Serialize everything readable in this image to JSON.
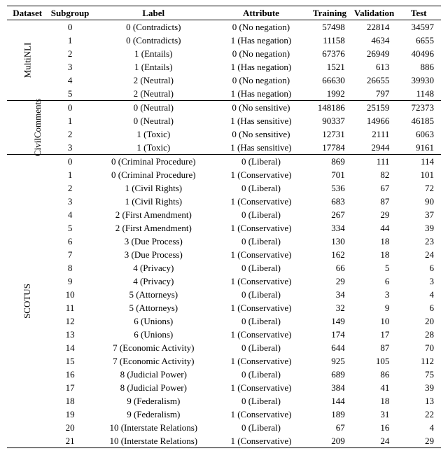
{
  "columns": {
    "dataset": "Dataset",
    "subgroup": "Subgroup",
    "label": "Label",
    "attribute": "Attribute",
    "training": "Training",
    "validation": "Validation",
    "test": "Test"
  },
  "groups": [
    {
      "name": "MultiNLI",
      "rows": [
        {
          "subgroup": "0",
          "label": "0 (Contradicts)",
          "attribute": "0 (No negation)",
          "training": "57498",
          "validation": "22814",
          "test": "34597"
        },
        {
          "subgroup": "1",
          "label": "0 (Contradicts)",
          "attribute": "1 (Has negation)",
          "training": "11158",
          "validation": "4634",
          "test": "6655"
        },
        {
          "subgroup": "2",
          "label": "1 (Entails)",
          "attribute": "0 (No negation)",
          "training": "67376",
          "validation": "26949",
          "test": "40496"
        },
        {
          "subgroup": "3",
          "label": "1 (Entails)",
          "attribute": "1 (Has negation)",
          "training": "1521",
          "validation": "613",
          "test": "886"
        },
        {
          "subgroup": "4",
          "label": "2 (Neutral)",
          "attribute": "0 (No negation)",
          "training": "66630",
          "validation": "26655",
          "test": "39930"
        },
        {
          "subgroup": "5",
          "label": "2 (Neutral)",
          "attribute": "1 (Has negation)",
          "training": "1992",
          "validation": "797",
          "test": "1148"
        }
      ]
    },
    {
      "name": "CivilComments",
      "rows": [
        {
          "subgroup": "0",
          "label": "0 (Neutral)",
          "attribute": "0 (No sensitive)",
          "training": "148186",
          "validation": "25159",
          "test": "72373"
        },
        {
          "subgroup": "1",
          "label": "0 (Neutral)",
          "attribute": "1 (Has sensitive)",
          "training": "90337",
          "validation": "14966",
          "test": "46185"
        },
        {
          "subgroup": "2",
          "label": "1 (Toxic)",
          "attribute": "0 (No sensitive)",
          "training": "12731",
          "validation": "2111",
          "test": "6063"
        },
        {
          "subgroup": "3",
          "label": "1 (Toxic)",
          "attribute": "1 (Has sensitive)",
          "training": "17784",
          "validation": "2944",
          "test": "9161"
        }
      ]
    },
    {
      "name": "SCOTUS",
      "rows": [
        {
          "subgroup": "0",
          "label": "0 (Criminal Procedure)",
          "attribute": "0 (Liberal)",
          "training": "869",
          "validation": "111",
          "test": "114"
        },
        {
          "subgroup": "1",
          "label": "0 (Criminal Procedure)",
          "attribute": "1 (Conservative)",
          "training": "701",
          "validation": "82",
          "test": "101"
        },
        {
          "subgroup": "2",
          "label": "1 (Civil Rights)",
          "attribute": "0 (Liberal)",
          "training": "536",
          "validation": "67",
          "test": "72"
        },
        {
          "subgroup": "3",
          "label": "1 (Civil Rights)",
          "attribute": "1 (Conservative)",
          "training": "683",
          "validation": "87",
          "test": "90"
        },
        {
          "subgroup": "4",
          "label": "2 (First Amendment)",
          "attribute": "0 (Liberal)",
          "training": "267",
          "validation": "29",
          "test": "37"
        },
        {
          "subgroup": "5",
          "label": "2 (First Amendment)",
          "attribute": "1 (Conservative)",
          "training": "334",
          "validation": "44",
          "test": "39"
        },
        {
          "subgroup": "6",
          "label": "3 (Due Process)",
          "attribute": "0 (Liberal)",
          "training": "130",
          "validation": "18",
          "test": "23"
        },
        {
          "subgroup": "7",
          "label": "3 (Due Process)",
          "attribute": "1 (Conservative)",
          "training": "162",
          "validation": "18",
          "test": "24"
        },
        {
          "subgroup": "8",
          "label": "4 (Privacy)",
          "attribute": "0 (Liberal)",
          "training": "66",
          "validation": "5",
          "test": "6"
        },
        {
          "subgroup": "9",
          "label": "4 (Privacy)",
          "attribute": "1 (Conservative)",
          "training": "29",
          "validation": "6",
          "test": "3"
        },
        {
          "subgroup": "10",
          "label": "5 (Attorneys)",
          "attribute": "0 (Liberal)",
          "training": "34",
          "validation": "3",
          "test": "4"
        },
        {
          "subgroup": "11",
          "label": "5 (Attorneys)",
          "attribute": "1 (Conservative)",
          "training": "32",
          "validation": "9",
          "test": "6"
        },
        {
          "subgroup": "12",
          "label": "6 (Unions)",
          "attribute": "0 (Liberal)",
          "training": "149",
          "validation": "10",
          "test": "20"
        },
        {
          "subgroup": "13",
          "label": "6 (Unions)",
          "attribute": "1 (Conservative)",
          "training": "174",
          "validation": "17",
          "test": "28"
        },
        {
          "subgroup": "14",
          "label": "7 (Economic Activity)",
          "attribute": "0 (Liberal)",
          "training": "644",
          "validation": "87",
          "test": "70"
        },
        {
          "subgroup": "15",
          "label": "7 (Economic Activity)",
          "attribute": "1 (Conservative)",
          "training": "925",
          "validation": "105",
          "test": "112"
        },
        {
          "subgroup": "16",
          "label": "8 (Judicial Power)",
          "attribute": "0 (Liberal)",
          "training": "689",
          "validation": "86",
          "test": "75"
        },
        {
          "subgroup": "17",
          "label": "8 (Judicial Power)",
          "attribute": "1 (Conservative)",
          "training": "384",
          "validation": "41",
          "test": "39"
        },
        {
          "subgroup": "18",
          "label": "9 (Federalism)",
          "attribute": "0 (Liberal)",
          "training": "144",
          "validation": "18",
          "test": "13"
        },
        {
          "subgroup": "19",
          "label": "9 (Federalism)",
          "attribute": "1 (Conservative)",
          "training": "189",
          "validation": "31",
          "test": "22"
        },
        {
          "subgroup": "20",
          "label": "10 (Interstate Relations)",
          "attribute": "0 (Liberal)",
          "training": "67",
          "validation": "16",
          "test": "4"
        },
        {
          "subgroup": "21",
          "label": "10 (Interstate Relations)",
          "attribute": "1 (Conservative)",
          "training": "209",
          "validation": "24",
          "test": "29"
        }
      ]
    }
  ]
}
